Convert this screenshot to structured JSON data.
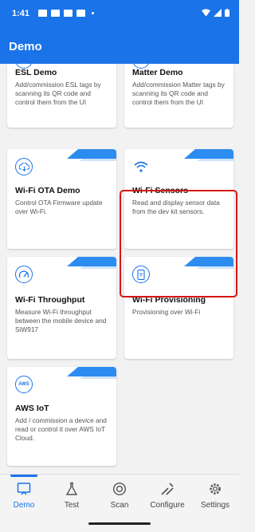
{
  "status_bar": {
    "time": "1:41",
    "icons": [
      "notification-icon",
      "youtube-icon",
      "youtube-icon",
      "youtube-icon",
      "dot-icon"
    ],
    "right_icons": [
      "wifi-icon",
      "signal-icon",
      "battery-icon"
    ]
  },
  "app_bar": {
    "title": "Demo"
  },
  "cards": [
    {
      "name": "esl-demo",
      "title": "ESL Demo",
      "description": "Add/commission ESL tags by scanning its QR code and control them from the UI",
      "icon": "tag-icon"
    },
    {
      "name": "matter-demo",
      "title": "Matter Demo",
      "description": "Add/commission Matter tags by scanning its QR code and control them from the UI",
      "icon": "matter-icon"
    },
    {
      "name": "wifi-ota-demo",
      "title": "Wi-Fi OTA Demo",
      "description": "Control OTA Firmware update over Wi-Fi.",
      "icon": "cloud-download-icon"
    },
    {
      "name": "wifi-sensors",
      "title": "Wi-Fi Sensors",
      "description": "Read and display sensor data from the dev kit sensors.",
      "icon": "wifi-icon"
    },
    {
      "name": "wifi-throughput",
      "title": "Wi-Fi Throughput",
      "description": "Measure Wi-Fi throughput between the mobile device and SiW917",
      "icon": "speedometer-icon"
    },
    {
      "name": "wifi-provisioning",
      "title": "Wi-Fi Provisioning",
      "description": "Provisioning over Wi-Fi",
      "icon": "phone-wifi-icon"
    },
    {
      "name": "aws-iot",
      "title": "AWS IoT",
      "description": "Add / commission a device and read or control it over AWS IoT Cloud.",
      "icon": "aws-icon",
      "icon_text": "AWS"
    }
  ],
  "bottom_nav": [
    {
      "label": "Demo",
      "icon": "demo-icon",
      "active": true
    },
    {
      "label": "Test",
      "icon": "flask-icon",
      "active": false
    },
    {
      "label": "Scan",
      "icon": "scan-icon",
      "active": false
    },
    {
      "label": "Configure",
      "icon": "tools-icon",
      "active": false
    },
    {
      "label": "Settings",
      "icon": "gear-icon",
      "active": false
    }
  ],
  "colors": {
    "primary": "#1a73e8",
    "highlight": "#d51616",
    "ribbon": "#2d8cf0"
  }
}
